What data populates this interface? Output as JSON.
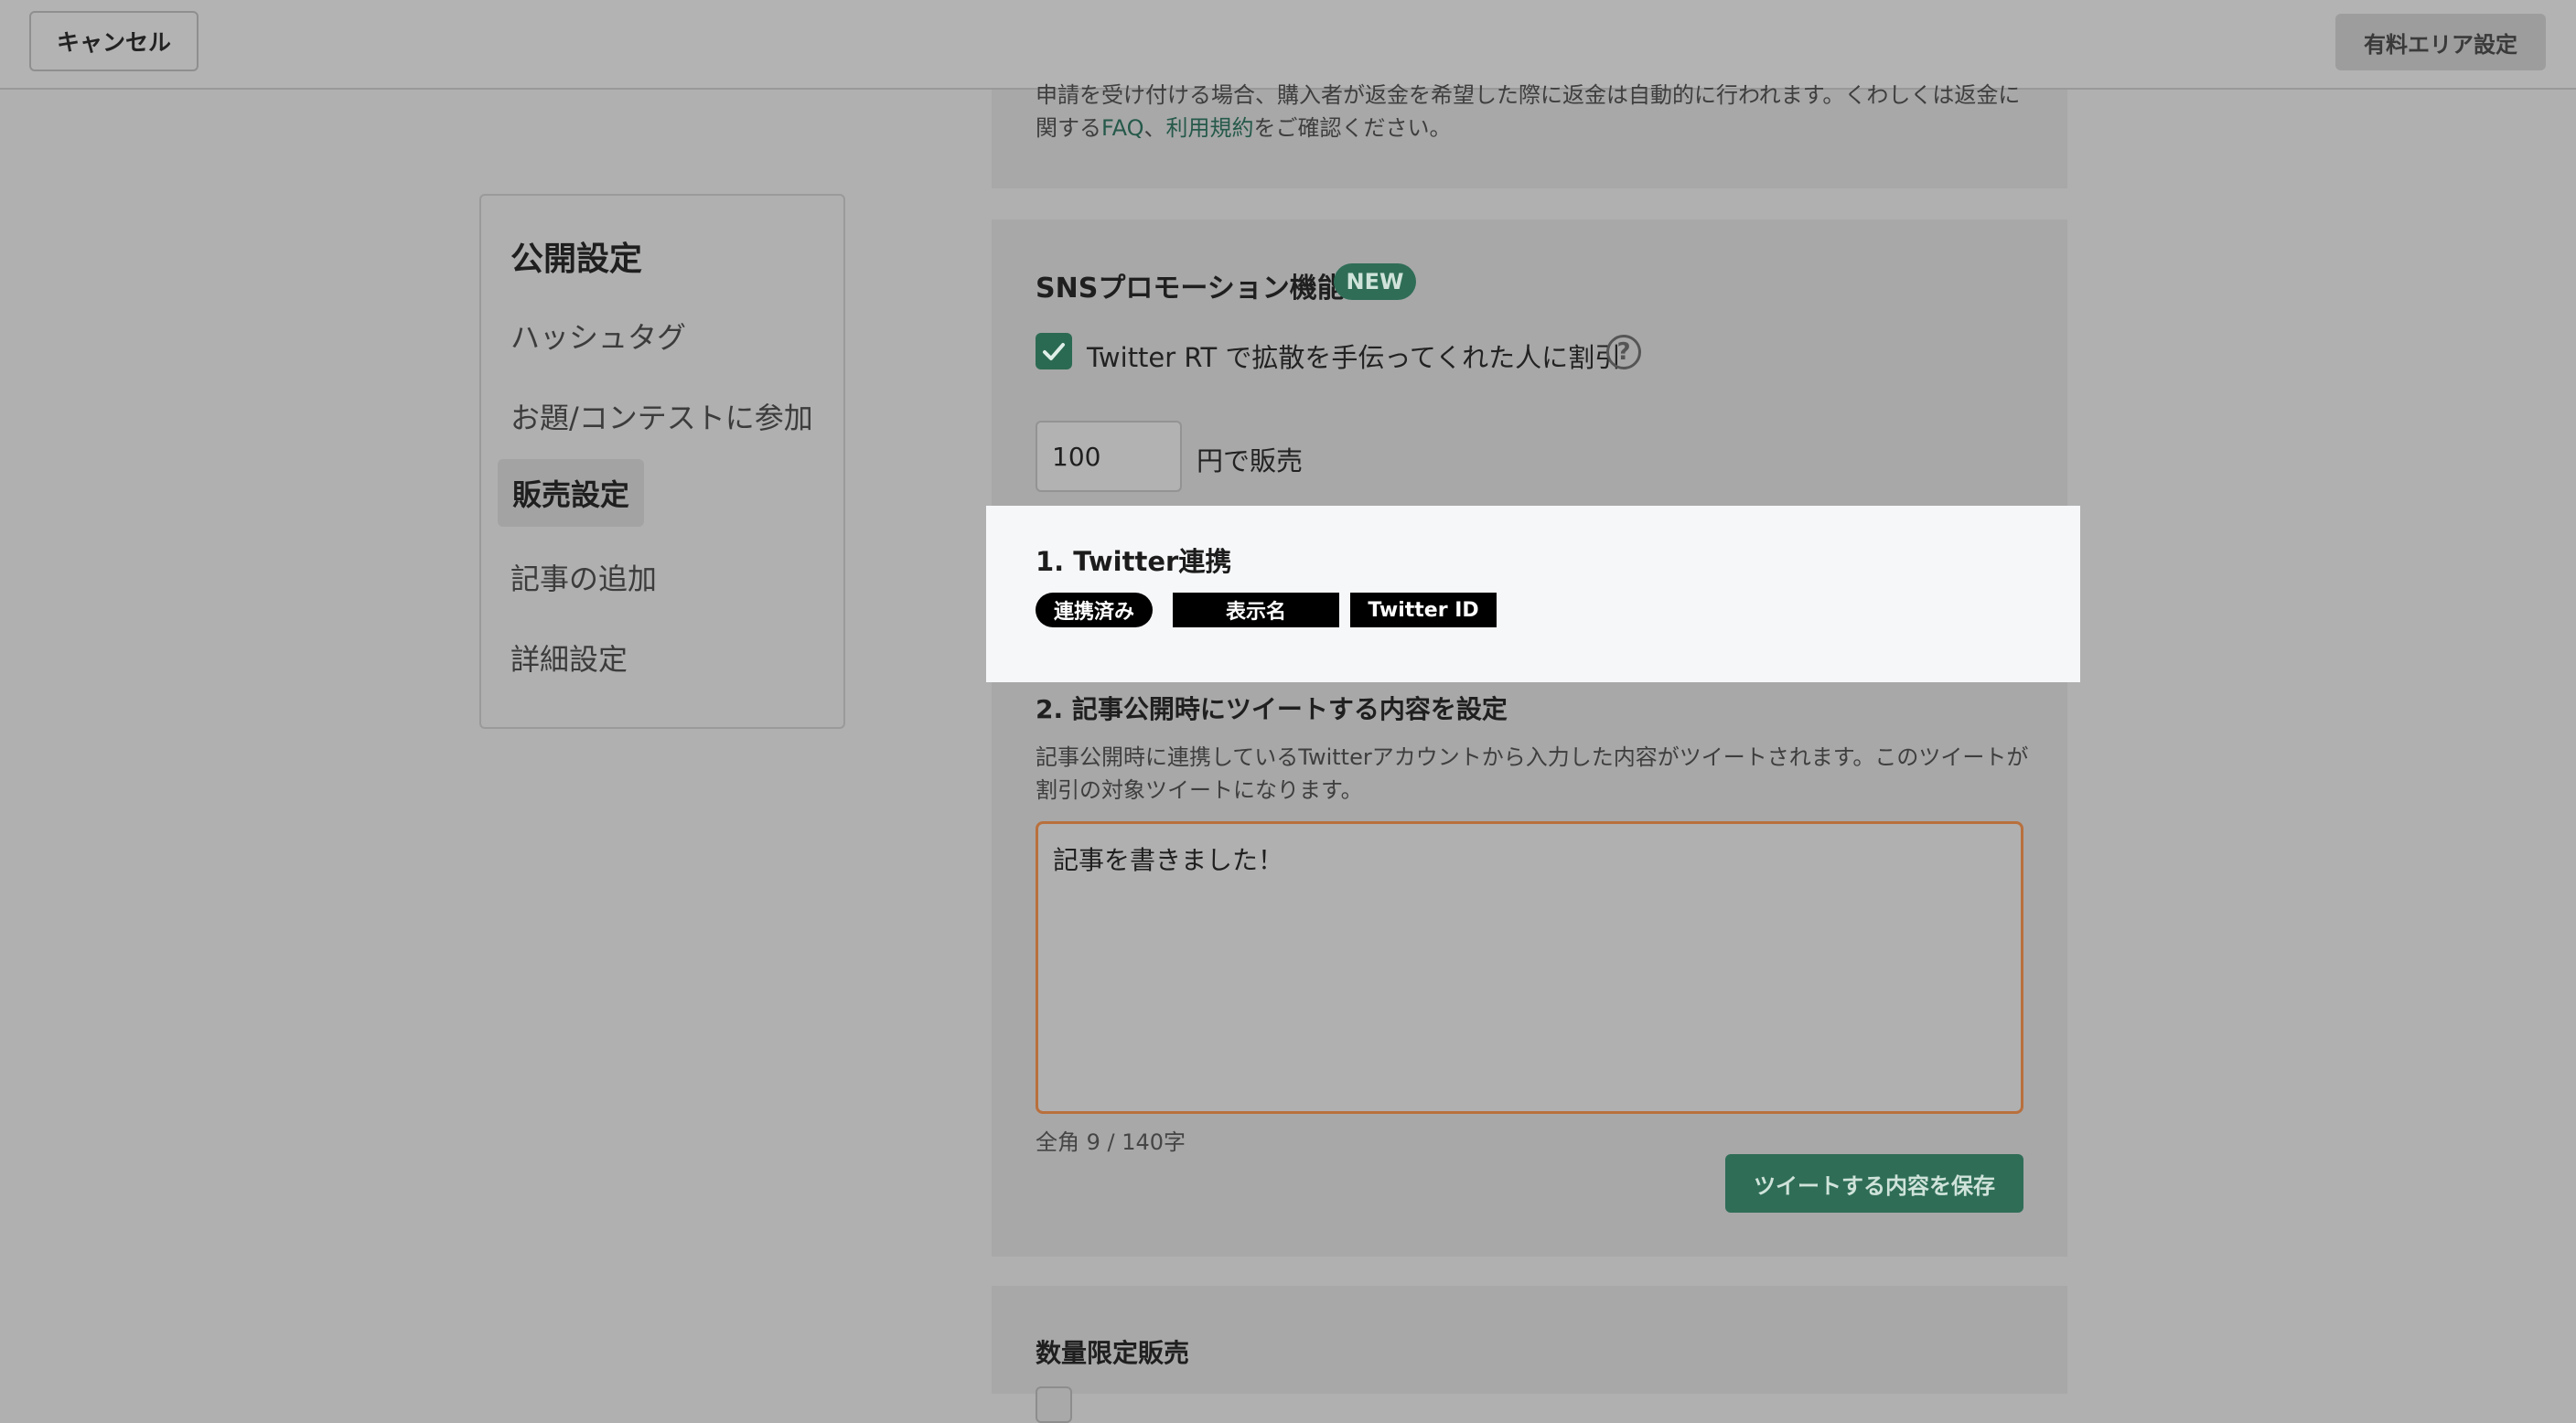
{
  "topbar": {
    "cancel_label": "キャンセル",
    "paid_area_label": "有料エリア設定"
  },
  "refund": {
    "text_before": "申請を受け付ける場合、購入者が返金を希望した際に返金は自動的に行われます。くわしくは返金に関する",
    "faq_link": "FAQ",
    "separator": "、",
    "terms_link": "利用規約",
    "text_after": "をご確認ください。"
  },
  "sidebar": {
    "title": "公開設定",
    "items": [
      {
        "label": "ハッシュタグ",
        "active": false
      },
      {
        "label": "お題/コンテストに参加",
        "active": false
      },
      {
        "label": "販売設定",
        "active": true
      },
      {
        "label": "記事の追加",
        "active": false
      },
      {
        "label": "詳細設定",
        "active": false
      }
    ]
  },
  "sns": {
    "title": "SNSプロモーション機能",
    "badge": "NEW",
    "checkbox_label": "Twitter RT で拡散を手伝ってくれた人に割引",
    "checked": true,
    "help_glyph": "?",
    "price_value": "100",
    "price_suffix": "円で販売",
    "twitter": {
      "title": "1. Twitter連携",
      "linked_tag": "連携済み",
      "display_name_tag": "表示名",
      "twitter_id_tag": "Twitter ID"
    },
    "tweet": {
      "title": "2. 記事公開時にツイートする内容を設定",
      "description": "記事公開時に連携しているTwitterアカウントから入力した内容がツイートされます。このツイートが割引の対象ツイートになります。",
      "value": "記事を書きました！",
      "counter": "全角 9 / 140字",
      "save_label": "ツイートする内容を保存"
    }
  },
  "limited": {
    "title": "数量限定販売"
  },
  "colors": {
    "accent": "#2f6d57",
    "textarea_border": "#b9703d",
    "overlay": "#b0b0b0",
    "highlight": "#f6f7f9"
  }
}
